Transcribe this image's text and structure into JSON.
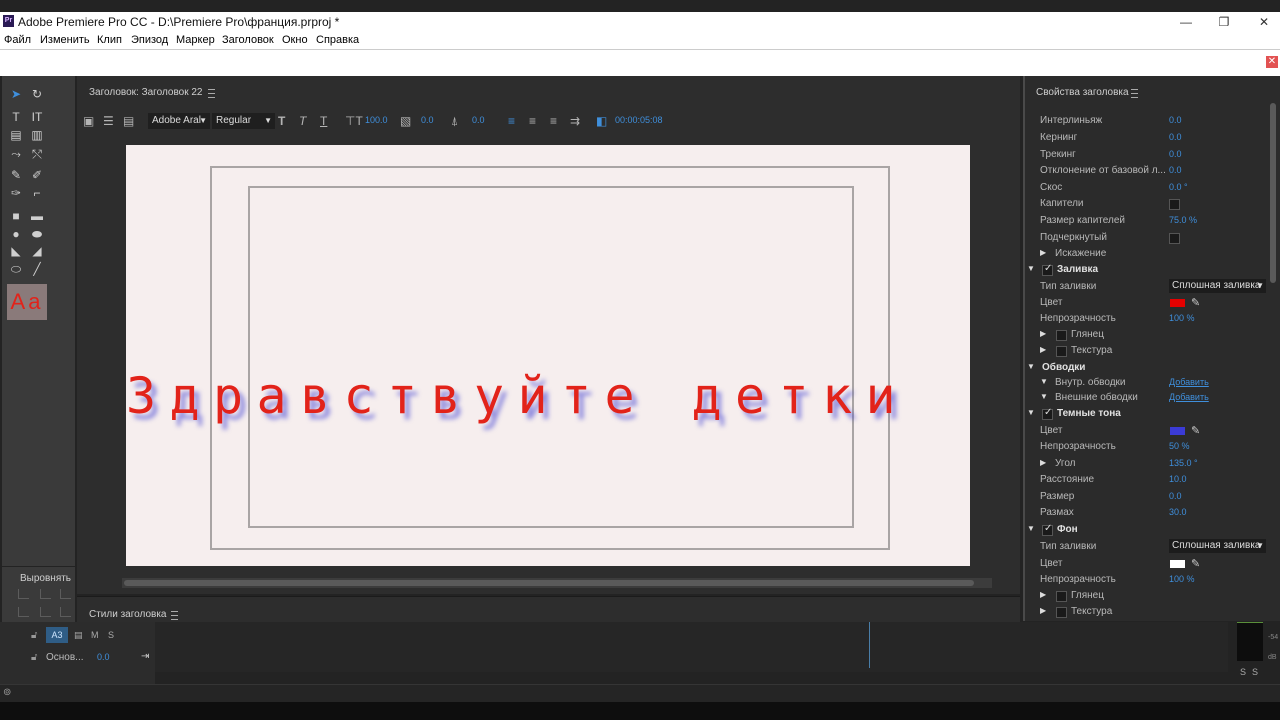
{
  "window": {
    "title": "Adobe Premiere Pro CC - D:\\Premiere Pro\\франция.prproj *",
    "app_icon": "Pr",
    "controls": [
      "—",
      "❐",
      "✕"
    ]
  },
  "menu": [
    "Файл",
    "Изменить",
    "Клип",
    "Эпизод",
    "Маркер",
    "Заголовок",
    "Окно",
    "Справка"
  ],
  "title_panel": {
    "header": "Заголовок: Заголовок 22",
    "font_family": "Adobe Aral",
    "font_style": "Regular",
    "font_size": "100.0",
    "leading_value": "0.0",
    "kerning_value": "0.0",
    "timecode": "00:00:05:08",
    "canvas_text": "Здравствуйте детки",
    "preview_glyph": "Aa"
  },
  "align_panel": {
    "label": "Выровнять"
  },
  "styles_panel": {
    "label": "Стили заголовка"
  },
  "properties": {
    "header": "Свойства заголовка",
    "rows": {
      "interline": {
        "label": "Интерлиньяж",
        "value": "0.0"
      },
      "kerning": {
        "label": "Кернинг",
        "value": "0.0"
      },
      "tracking": {
        "label": "Трекинг",
        "value": "0.0"
      },
      "baseline": {
        "label": "Отклонение от базовой л...",
        "value": "0.0"
      },
      "slant": {
        "label": "Скос",
        "value": "0.0 °"
      },
      "caps": {
        "label": "Капители"
      },
      "caps_size": {
        "label": "Размер капителей",
        "value": "75.0 %"
      },
      "underline": {
        "label": "Подчеркнутый"
      },
      "distortion": {
        "label": "Искажение"
      },
      "fill": {
        "label": "Заливка"
      },
      "fill_type": {
        "label": "Тип заливки",
        "value": "Сплошная заливка"
      },
      "fill_color": {
        "label": "Цвет",
        "color": "#e50000"
      },
      "fill_opacity": {
        "label": "Непрозрачность",
        "value": "100 %"
      },
      "gloss": {
        "label": "Глянец"
      },
      "texture": {
        "label": "Текстура"
      },
      "strokes": {
        "label": "Обводки"
      },
      "inner_strokes": {
        "label": "Внутр. обводки",
        "link": "Добавить"
      },
      "outer_strokes": {
        "label": "Внешние обводки",
        "link": "Добавить"
      },
      "shadow": {
        "label": "Темные тона"
      },
      "shadow_color": {
        "label": "Цвет",
        "color": "#3b3bd6"
      },
      "shadow_opacity": {
        "label": "Непрозрачность",
        "value": "50 %"
      },
      "shadow_angle": {
        "label": "Угол",
        "value": "135.0 °"
      },
      "shadow_distance": {
        "label": "Расстояние",
        "value": "10.0"
      },
      "shadow_size": {
        "label": "Размер",
        "value": "0.0"
      },
      "shadow_spread": {
        "label": "Размах",
        "value": "30.0"
      },
      "background": {
        "label": "Фон"
      },
      "bg_fill_type": {
        "label": "Тип заливки",
        "value": "Сплошная заливка"
      },
      "bg_color": {
        "label": "Цвет",
        "color": "#ffffff"
      },
      "bg_opacity": {
        "label": "Непрозрачность",
        "value": "100 %"
      },
      "bg_gloss": {
        "label": "Глянец"
      },
      "bg_texture": {
        "label": "Текстура"
      }
    }
  },
  "timeline": {
    "track_name": "A3",
    "m": "M",
    "s": "S",
    "master_label": "Основ...",
    "master_value": "0.0",
    "meter_top": "-54",
    "meter_unit": "dB",
    "solo_left": "S",
    "solo_right": "S"
  }
}
